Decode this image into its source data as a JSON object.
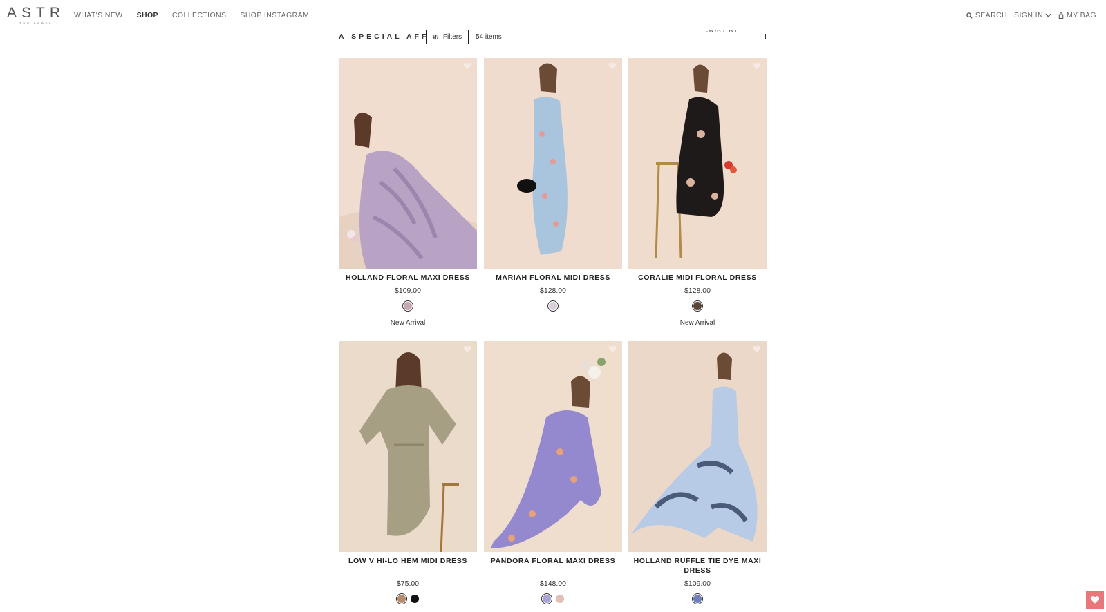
{
  "header": {
    "logo_main": "ASTR",
    "logo_sub": "THE LABEL",
    "nav": [
      "WHAT'S NEW",
      "SHOP",
      "COLLECTIONS",
      "SHOP INSTAGRAM"
    ],
    "active_nav": "SHOP",
    "search_label": "SEARCH",
    "signin_label": "SIGN IN",
    "bag_label": "MY BAG"
  },
  "toolbar": {
    "collection_title": "A SPECIAL AFFAIR",
    "filters_label": "Filters",
    "item_count": "54 items",
    "sort_label": "SORT BY"
  },
  "products": [
    {
      "name": "HOLLAND FLORAL MAXI DRESS",
      "price": "$109.00",
      "swatches": [
        "#c7a9b6"
      ],
      "badge": "New Arrival",
      "image_colors": {
        "bg": "#f0ddd0",
        "dress": "#b8a3c4",
        "accent": "#9d86ad"
      }
    },
    {
      "name": "MARIAH FLORAL MIDI DRESS",
      "price": "$128.00",
      "swatches": [
        "#d9cfd9"
      ],
      "badge": "",
      "image_colors": {
        "bg": "#efdccf",
        "dress": "#a9c4dd",
        "accent": "#e59a95"
      }
    },
    {
      "name": "CORALIE MIDI FLORAL DRESS",
      "price": "$128.00",
      "swatches": [
        "#5a4638"
      ],
      "badge": "New Arrival",
      "image_colors": {
        "bg": "#efdccd",
        "dress": "#1f1a1a",
        "accent": "#d9b3a0"
      }
    },
    {
      "name": "LOW V HI-LO HEM MIDI DRESS",
      "price": "$75.00",
      "swatches": [
        "#b58d6e",
        "#111111"
      ],
      "badge": "",
      "image_colors": {
        "bg": "#eadbcb",
        "dress": "#a79f84",
        "accent": "#8f876d"
      }
    },
    {
      "name": "PANDORA FLORAL MAXI DRESS",
      "price": "$148.00",
      "swatches": [
        "#a9a3d6",
        "#e0c0b8"
      ],
      "badge": "",
      "image_colors": {
        "bg": "#efdece",
        "dress": "#9488cf",
        "accent": "#e8a079"
      }
    },
    {
      "name": "HOLLAND RUFFLE TIE DYE MAXI DRESS",
      "price": "$109.00",
      "swatches": [
        "#6f7fb8"
      ],
      "badge": "",
      "image_colors": {
        "bg": "#ecd8c8",
        "dress": "#b7cbe6",
        "accent": "#4a5b7a"
      }
    }
  ],
  "colors": {
    "chat_button": "#e8777a",
    "text": "#222222"
  }
}
